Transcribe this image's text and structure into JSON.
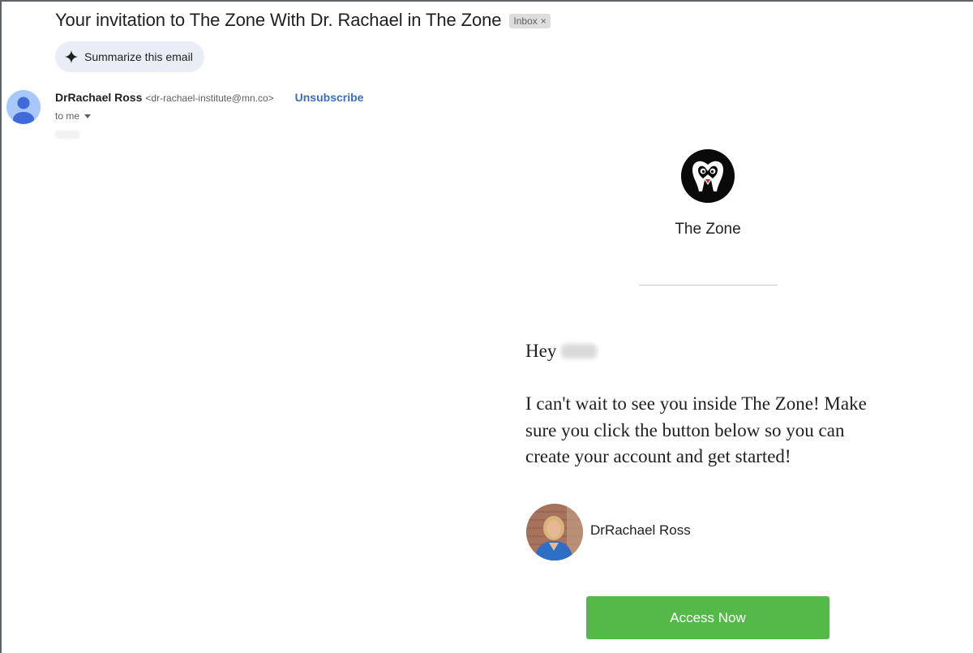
{
  "email": {
    "subject": "Your invitation to The Zone With Dr. Rachael in The Zone",
    "label_chip": "Inbox",
    "label_remove_glyph": "×",
    "summarize_label": "Summarize this email",
    "sender": {
      "name": "DrRachael Ross",
      "email": "<dr-rachael-institute@mn.co>",
      "unsubscribe_label": "Unsubscribe",
      "recipient_label": "to me"
    }
  },
  "body": {
    "brand_name": "The Zone",
    "greeting": "Hey",
    "message": "I can't wait to see you inside The Zone! Make sure you click the button below so you can create your account and get started!",
    "author_name": "DrRachael Ross",
    "cta_label": "Access Now"
  },
  "colors": {
    "cta_green": "#54b948",
    "link_blue": "#3d6fb7",
    "summarize_bg": "#e9eef6",
    "avatar_blue": "#a8c7fa",
    "logo_black": "#0a0a0a"
  },
  "icons": {
    "summarize": "sparkle-icon",
    "recipient_expand": "caret-down-icon",
    "avatar": "person-avatar-icon",
    "brand": "the-zone-logo"
  }
}
